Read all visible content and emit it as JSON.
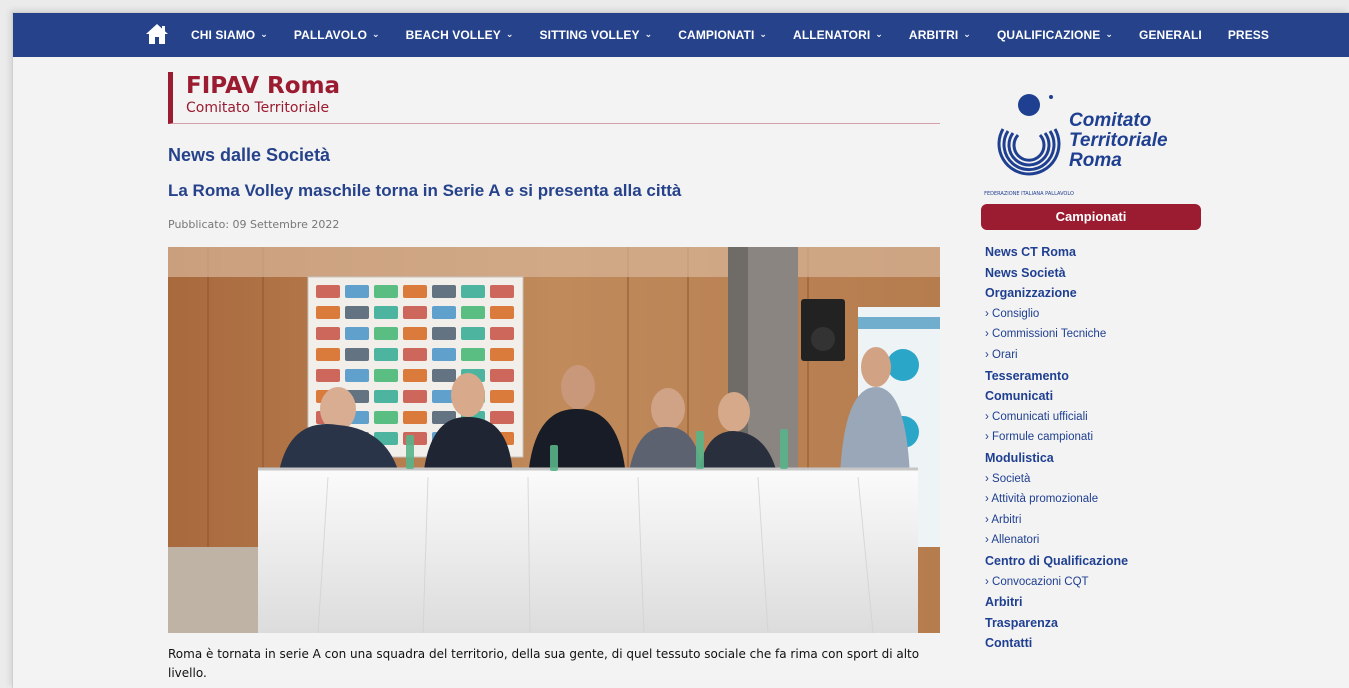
{
  "nav": {
    "items": [
      {
        "label": "CHI SIAMO",
        "dropdown": true
      },
      {
        "label": "PALLAVOLO",
        "dropdown": true
      },
      {
        "label": "BEACH VOLLEY",
        "dropdown": true
      },
      {
        "label": "SITTING VOLLEY",
        "dropdown": true
      },
      {
        "label": "CAMPIONATI",
        "dropdown": true
      },
      {
        "label": "ALLENATORI",
        "dropdown": true
      },
      {
        "label": "ARBITRI",
        "dropdown": true
      },
      {
        "label": "QUALIFICAZIONE",
        "dropdown": true
      },
      {
        "label": "GENERALI",
        "dropdown": false
      },
      {
        "label": "PRESS",
        "dropdown": false
      }
    ],
    "chevron": "⌄"
  },
  "header": {
    "title": "FIPAV Roma",
    "subtitle": "Comitato Territoriale"
  },
  "article": {
    "section": "News dalle Società",
    "title": "La Roma Volley maschile torna in Serie A e si presenta alla città",
    "published": "Pubblicato: 09 Settembre 2022",
    "body": "Roma è tornata in serie A con una squadra del territorio, della sua gente, di quel tessuto sociale che fa rima con sport di alto livello."
  },
  "logo": {
    "line1": "Comitato",
    "line2": "Territoriale",
    "line3": "Roma",
    "ring_text": "FEDERAZIONE ITALIANA PALLAVOLO"
  },
  "sidebar": {
    "heading": "Campionati",
    "items": [
      {
        "label": "News CT Roma",
        "type": "main"
      },
      {
        "label": "News Società",
        "type": "main"
      },
      {
        "label": "Organizzazione",
        "type": "main"
      },
      {
        "label": "› Consiglio",
        "type": "sub"
      },
      {
        "label": "› Commissioni Tecniche",
        "type": "sub"
      },
      {
        "label": "› Orari",
        "type": "sub"
      },
      {
        "label": "Tesseramento",
        "type": "main"
      },
      {
        "label": "Comunicati",
        "type": "main"
      },
      {
        "label": "› Comunicati ufficiali",
        "type": "sub"
      },
      {
        "label": "› Formule campionati",
        "type": "sub"
      },
      {
        "label": "Modulistica",
        "type": "main"
      },
      {
        "label": "› Società",
        "type": "sub"
      },
      {
        "label": "› Attività promozionale",
        "type": "sub"
      },
      {
        "label": "› Arbitri",
        "type": "sub"
      },
      {
        "label": "› Allenatori",
        "type": "sub"
      },
      {
        "label": "Centro di Qualificazione",
        "type": "main"
      },
      {
        "label": "› Convocazioni CQT",
        "type": "sub"
      },
      {
        "label": "Arbitri",
        "type": "main"
      },
      {
        "label": "Trasparenza",
        "type": "main"
      },
      {
        "label": "Contatti",
        "type": "main"
      }
    ]
  },
  "colors": {
    "nav_bg": "#25428b",
    "brand_red": "#9b1b30",
    "link_blue": "#1f3f91"
  }
}
